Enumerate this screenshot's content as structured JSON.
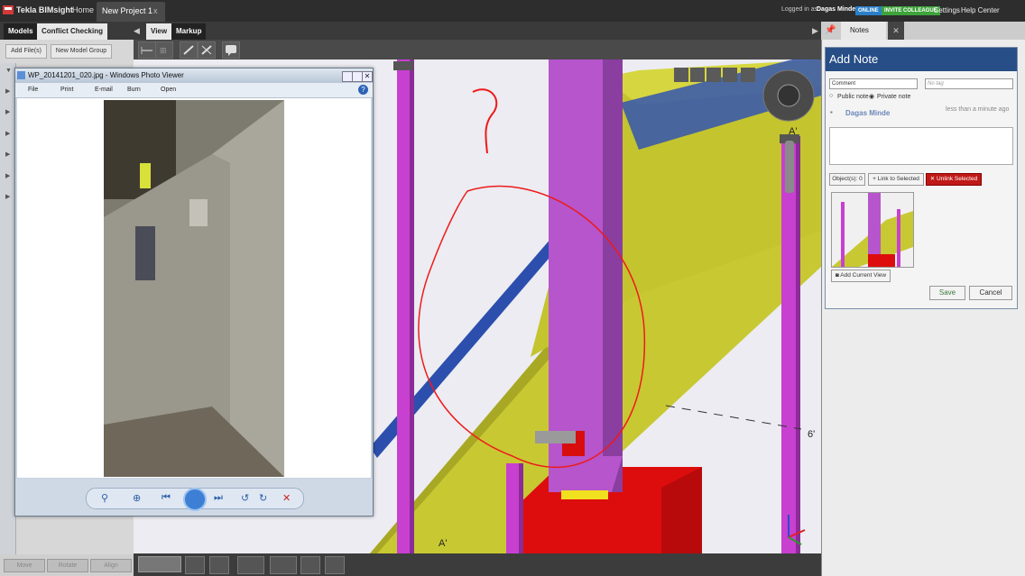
{
  "app": {
    "title": "Tekla BIMsight",
    "home": "Home",
    "project_tab": "New Project 1",
    "close": "x"
  },
  "topright": {
    "logged_in_as": "Logged in as:",
    "user": "Dagas Minde",
    "online": "ONLINE",
    "invite": "INVITE COLLEAGUE",
    "settings": "Settings",
    "help": "Help Center"
  },
  "left_tabs": [
    "Models",
    "Conflict Checking"
  ],
  "view_tabs": [
    "View",
    "Markup"
  ],
  "left_buttons": {
    "add_files": "Add File(s)",
    "new_group": "New Model Group"
  },
  "bottom_buttons": [
    "Move",
    "Rotate",
    "Align"
  ],
  "photo_viewer": {
    "title": "WP_20141201_020.jpg - Windows Photo Viewer",
    "menu": [
      "File",
      "Print",
      "E-mail",
      "Burn",
      "Open"
    ]
  },
  "viewport": {
    "question_mark": "?",
    "labels": [
      "A'",
      "A'",
      "6'"
    ]
  },
  "notes": {
    "tab": "Notes",
    "header": "Add Note",
    "type_value": "Comment",
    "tag_placeholder": "No tag",
    "public": "Public note",
    "private": "Private note",
    "author": "Dagas Minde",
    "time": "less than a minute ago",
    "objects_label": "Object(s):",
    "objects_count": "0",
    "link": "Link to Selected",
    "unlink": "Unlink Selected",
    "add_view": "Add Current View",
    "save": "Save",
    "cancel": "Cancel"
  },
  "colors": {
    "beam": "#c8c833",
    "column": "#b44dc8",
    "base": "#e01010",
    "notes_header": "#274e86",
    "unlink": "#c01818"
  }
}
